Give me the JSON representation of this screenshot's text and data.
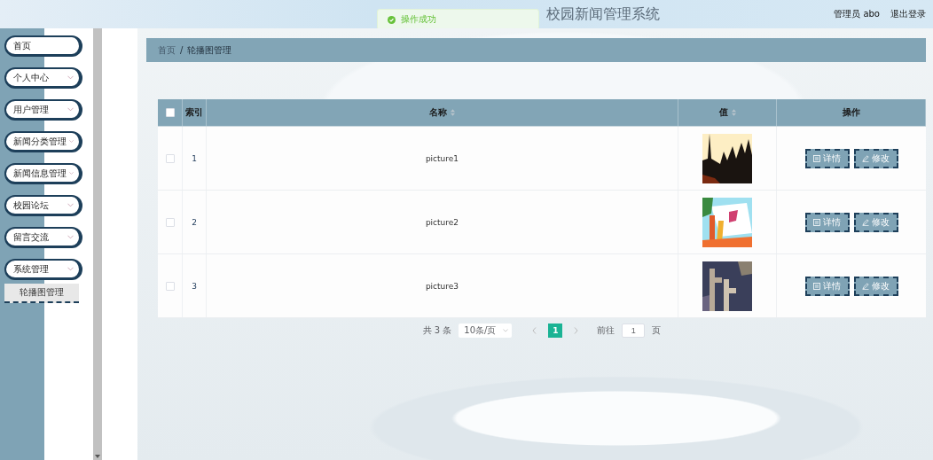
{
  "header": {
    "title": "校园新闻管理系统",
    "user": "管理员 abo",
    "logout": "退出登录"
  },
  "toast": {
    "message": "操作成功"
  },
  "sidebar": {
    "items": [
      {
        "label": "首页",
        "kind": "link"
      },
      {
        "label": "个人中心",
        "kind": "submenu"
      },
      {
        "label": "用户管理",
        "kind": "submenu"
      },
      {
        "label": "新闻分类管理",
        "kind": "submenu"
      },
      {
        "label": "新闻信息管理",
        "kind": "submenu"
      },
      {
        "label": "校园论坛",
        "kind": "submenu"
      },
      {
        "label": "留言交流",
        "kind": "submenu"
      },
      {
        "label": "系统管理",
        "kind": "submenu",
        "children": [
          {
            "label": "轮播图管理",
            "selected": true
          }
        ]
      }
    ]
  },
  "breadcrumb": {
    "separator": "/",
    "items": [
      "首页",
      "轮播图管理"
    ]
  },
  "table": {
    "select_all": {
      "checked": false
    },
    "columns": [
      {
        "label": "索引",
        "sortable": false
      },
      {
        "label": "名称",
        "sortable": true
      },
      {
        "label": "值",
        "sortable": true
      },
      {
        "label": "操作",
        "sortable": false
      }
    ],
    "rows": [
      {
        "checked": false,
        "index": "1",
        "name": "picture1",
        "value": {
          "kind": "picture"
        },
        "actions": [
          "详情",
          "修改"
        ]
      },
      {
        "checked": false,
        "index": "2",
        "name": "picture2",
        "value": {
          "kind": "picture"
        },
        "actions": [
          "详情",
          "修改"
        ]
      },
      {
        "checked": false,
        "index": "3",
        "name": "picture3",
        "value": {
          "kind": "picture"
        },
        "actions": [
          "详情",
          "修改"
        ]
      }
    ]
  },
  "pagination": {
    "total": "共 3 条",
    "page_size": "10条/页",
    "pages": [
      {
        "label": "1",
        "selected": true
      }
    ],
    "goto_label": "前往",
    "goto_value": "1",
    "page_unit": "页"
  }
}
